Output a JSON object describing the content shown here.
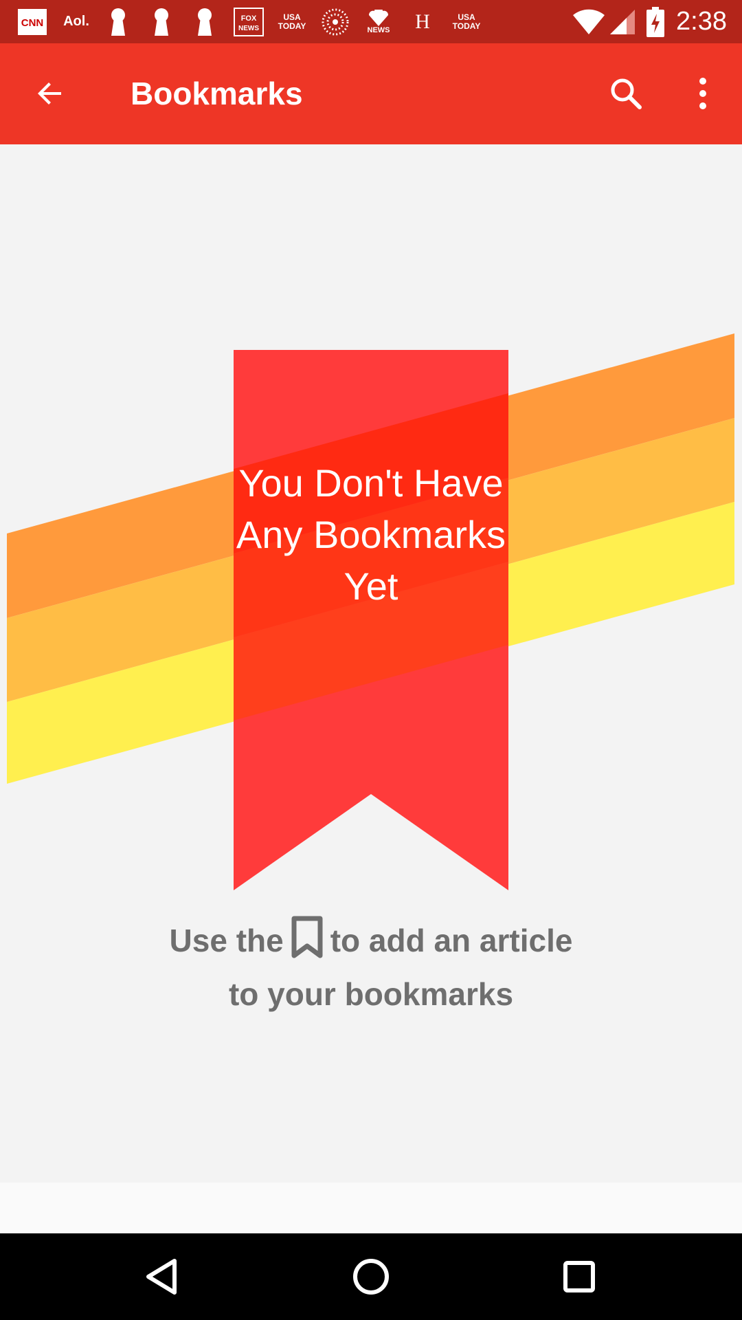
{
  "status_bar": {
    "notifications": [
      "CNN",
      "Aol.",
      "keyhole",
      "keyhole",
      "keyhole",
      "FOX NEWS",
      "USA TODAY",
      "Reuters",
      "NBC NEWS",
      "H",
      "USA TODAY"
    ],
    "time": "2:38"
  },
  "app_bar": {
    "title": "Bookmarks",
    "back_icon": "arrow-back-icon",
    "search_icon": "search-icon",
    "overflow_icon": "more-vert-icon"
  },
  "empty_state": {
    "title": "You Don't Have Any Bookmarks Yet",
    "hint_before": "Use the",
    "hint_after": "to add an article to your bookmarks",
    "hint_icon": "bookmark-outline-icon"
  },
  "nav_bar": {
    "back": "back-triangle-icon",
    "home": "home-circle-icon",
    "recents": "recents-square-icon"
  },
  "colors": {
    "status_bar": "#b3251a",
    "app_bar": "#ee3626",
    "ribbon": "#ff3b3b",
    "stripe_orange": "#ff9a3c",
    "stripe_amber": "#ffbd45",
    "stripe_yellow": "#ffef4f"
  }
}
